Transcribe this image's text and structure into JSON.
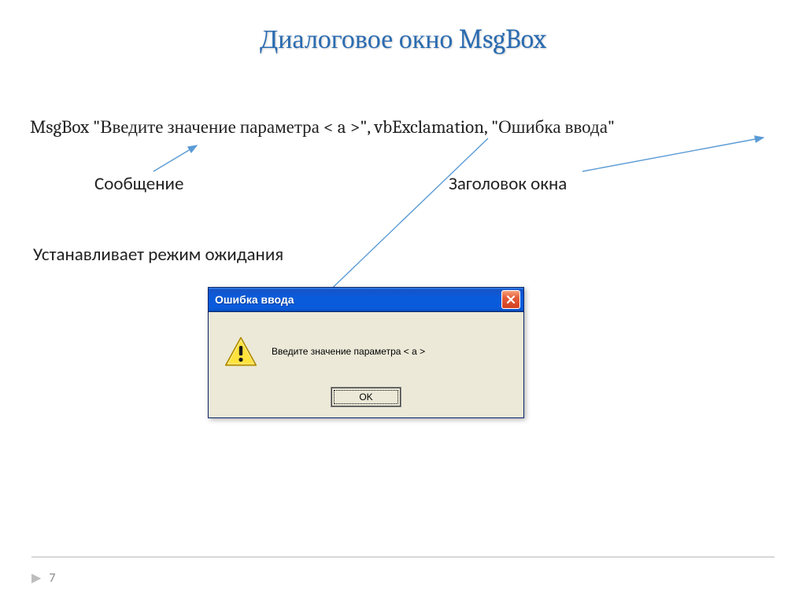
{
  "title": "Диалоговое окно MsgBox",
  "code": {
    "line1": "MsgBox \"Введите значение параметра < a >\",  vbExclamation, \"Ошибка ввода\"",
    "line2": ""
  },
  "labels": {
    "message": "Сообщение",
    "window_title": "Заголовок окна",
    "wait_mode": "Устанавливает режим ожидания"
  },
  "dialog": {
    "title": "Ошибка ввода",
    "message": "Введите значение параметра < a >",
    "ok": "OK"
  },
  "page_number": "7"
}
